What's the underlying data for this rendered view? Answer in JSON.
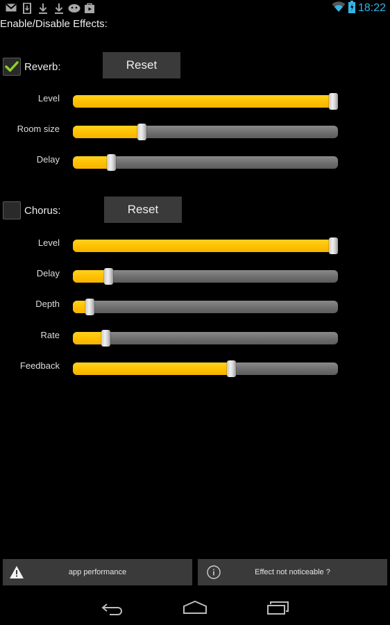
{
  "statusbar": {
    "notifications": [
      "gmail-icon",
      "sd-card-icon",
      "download-icon",
      "download-icon",
      "android-icon",
      "play-store-icon"
    ],
    "time": "18:22",
    "wifi": "wifi-icon",
    "battery": "battery-charging-icon"
  },
  "heading": "Enable/Disable Effects:",
  "reverb": {
    "label": "Reverb:",
    "enabled": true,
    "reset_label": "Reset",
    "sliders": [
      {
        "label": "Level",
        "value": 1.0
      },
      {
        "label": "Room size",
        "value": 0.25
      },
      {
        "label": "Delay",
        "value": 0.13
      }
    ]
  },
  "chorus": {
    "label": "Chorus:",
    "enabled": false,
    "reset_label": "Reset",
    "sliders": [
      {
        "label": "Level",
        "value": 1.0
      },
      {
        "label": "Delay",
        "value": 0.12
      },
      {
        "label": "Depth",
        "value": 0.045
      },
      {
        "label": "Rate",
        "value": 0.11
      },
      {
        "label": "Feedback",
        "value": 0.6
      }
    ]
  },
  "bottom": {
    "performance_label": "app performance",
    "noticeable_label": "Effect not noticeable ?"
  },
  "colors": {
    "accent": "#ffc000",
    "clock": "#33b5e5",
    "check": "#8fd12a"
  }
}
